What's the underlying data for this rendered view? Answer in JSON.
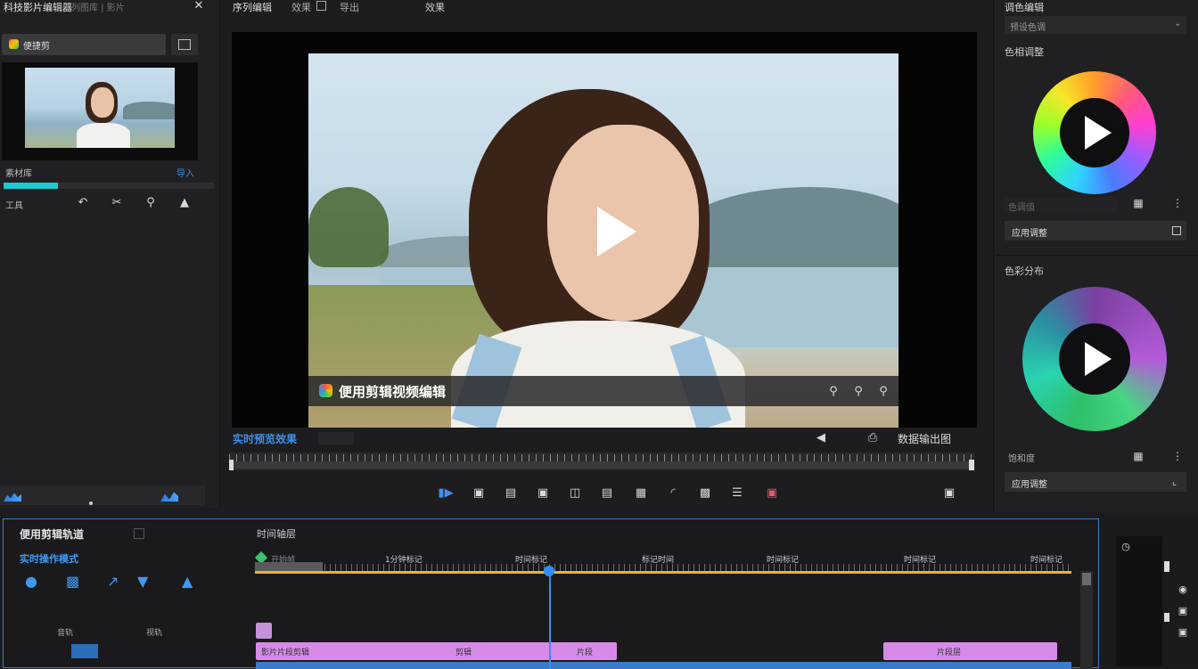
{
  "window": {
    "title": "科技影片编辑器",
    "title_meta": "序列图库 | 影片",
    "close_glyph": "✕"
  },
  "top_menu": {
    "items": [
      "序列编辑",
      "效果",
      "导出"
    ],
    "extra": "效果"
  },
  "left": {
    "media_label": "便捷剪",
    "section_label": "素材库",
    "section_action": "导入",
    "progress_percent": 26,
    "tools_label": "工具",
    "accent": "#20c9d2"
  },
  "preview": {
    "caption": "便用剪辑视频编辑",
    "status_label": "实时预览效果",
    "time_text": "数据输出图",
    "accent": "#3f8fe8"
  },
  "right": {
    "header": "调色编辑",
    "dropdown_value": "预设色调",
    "section1": "色相调整",
    "row1_label": "色调值",
    "button1": "应用调整",
    "section2": "色彩分布",
    "row2_label": "饱和度",
    "button2": "应用调整"
  },
  "timeline": {
    "title": "便用剪辑轨道",
    "mode_label": "实时操作模式",
    "header": "时间轴层",
    "start_label": "开始帧",
    "ruler_labels": [
      "1分钟标记",
      "时间标记",
      "标记时间",
      "时间标记",
      "时间标记",
      "时间标记"
    ],
    "track_rows": [
      {
        "name": "音轨"
      },
      {
        "name": "视轨"
      }
    ],
    "clip_texts": [
      "影片片段剪辑",
      "剪辑",
      "片段",
      "片段层"
    ],
    "track_color": "#d88ae8",
    "playhead_color": "#2f8fff",
    "ruler_color": "#e9b52b"
  }
}
